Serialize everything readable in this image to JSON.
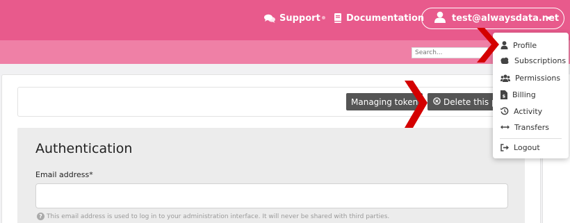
{
  "header": {
    "support_label": "Support",
    "documentation_label": "Documentation",
    "user_email": "test@alwaysdata.net"
  },
  "search": {
    "placeholder": "Search..."
  },
  "toolbar": {
    "managing_tokens_label": "Managing tokens",
    "delete_label": "Delete this profile"
  },
  "form": {
    "section_title": "Authentication",
    "email_label": "Email address*",
    "email_value": "",
    "email_help": "This email address is used to log in to your administration interface. It will never be shared with third parties."
  },
  "user_menu": {
    "items": [
      {
        "label": "Profile",
        "icon": "user-icon"
      },
      {
        "label": "Subscriptions",
        "icon": "cloud-icon"
      },
      {
        "label": "Permissions",
        "icon": "users-icon"
      },
      {
        "label": "Billing",
        "icon": "invoice-icon"
      },
      {
        "label": "Activity",
        "icon": "history-icon"
      },
      {
        "label": "Transfers",
        "icon": "transfer-icon"
      },
      {
        "label": "Logout",
        "icon": "logout-icon"
      }
    ]
  },
  "colors": {
    "header_bg": "#e85a8c",
    "subheader_bg": "#ef80a6",
    "annotation_arrow": "#d40000",
    "button_dark": "#555555"
  }
}
